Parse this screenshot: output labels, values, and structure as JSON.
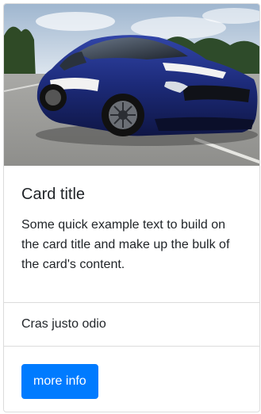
{
  "card": {
    "title": "Card title",
    "text": "Some quick example text to build on the card title and make up the bulk of the card's content.",
    "list_item": "Cras justo odio",
    "button_label": "more info"
  },
  "colors": {
    "button": "#007bff",
    "car_body": "#1c2a78",
    "sky": "#c8d8ea"
  },
  "icons": {
    "image": "car-photo"
  }
}
